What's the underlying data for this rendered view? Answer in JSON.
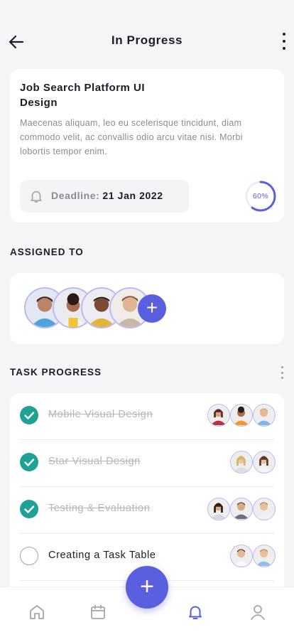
{
  "header": {
    "title": "In Progress"
  },
  "project": {
    "title": "Job Search Platform UI Design",
    "description": "Maecenas aliquam, leo eu scelerisque tincidunt, diam commodo velit, ac convallis odio arcu vitae nisi. Morbi lobortis tempor enim.",
    "deadline_label": "Deadline:",
    "deadline_date": "21 Jan 2022",
    "progress": 0.6,
    "progress_label": "60%"
  },
  "assigned": {
    "heading": "ASSIGNED TO",
    "avatars": [
      "person-1",
      "person-2",
      "person-3",
      "person-4"
    ],
    "add_label": "+"
  },
  "tasks": {
    "heading": "TASK PROGRESS",
    "items": [
      {
        "label": "Mobile Visual Design",
        "done": true
      },
      {
        "label": "Star Visual Design",
        "done": true
      },
      {
        "label": "Testing & Evaluation",
        "done": true
      },
      {
        "label": "Creating a Task Table",
        "done": false
      }
    ]
  },
  "tabbar": {
    "items": [
      "home-icon",
      "calendar-icon",
      "bell-icon",
      "profile-icon"
    ],
    "active": "bell-icon",
    "fab_label": "+"
  },
  "colors": {
    "accent": "#5a5fe0",
    "check": "#1fa196",
    "background": "#f5f5f7"
  }
}
